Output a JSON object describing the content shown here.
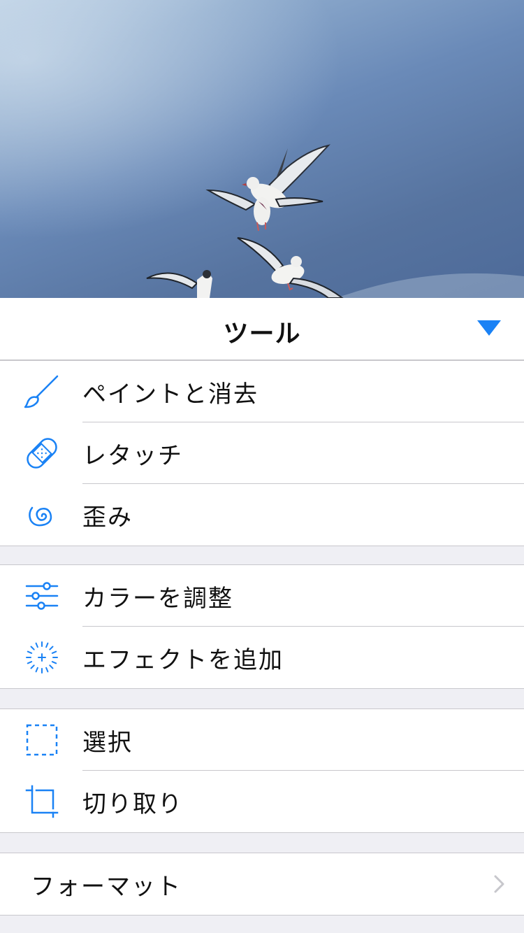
{
  "panel": {
    "title": "ツール"
  },
  "groups": [
    {
      "items": [
        {
          "label": "ペイントと消去",
          "icon": "paintbrush-icon"
        },
        {
          "label": "レタッチ",
          "icon": "bandage-icon"
        },
        {
          "label": "歪み",
          "icon": "spiral-icon"
        }
      ]
    },
    {
      "items": [
        {
          "label": "カラーを調整",
          "icon": "sliders-icon"
        },
        {
          "label": "エフェクトを追加",
          "icon": "sparkle-plus-icon"
        }
      ]
    },
    {
      "items": [
        {
          "label": "選択",
          "icon": "dashed-selection-icon"
        },
        {
          "label": "切り取り",
          "icon": "crop-icon"
        }
      ]
    },
    {
      "items": [
        {
          "label": "フォーマット",
          "icon": "chevron-right-icon"
        }
      ]
    }
  ],
  "colors": {
    "accent": "#1a82f5",
    "separator": "#c8c7cc",
    "background": "#efeff4",
    "chevron": "#c7c7cc"
  }
}
